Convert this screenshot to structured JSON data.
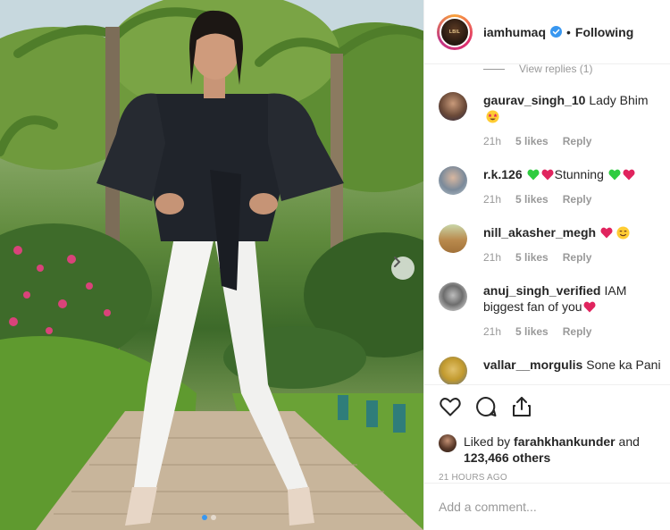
{
  "post": {
    "username": "iamhumaq",
    "follow_status": "Following",
    "separator": "•",
    "avatar_badge": "LBIL",
    "carousel": {
      "total": 2,
      "active": 1
    }
  },
  "comments": {
    "view_replies": "View replies (1)",
    "items": [
      {
        "user": "gaurav_singh_10",
        "text": "Lady Bhim",
        "emoji": "star-struck-face",
        "time": "21h",
        "likes": "5 likes",
        "reply": "Reply"
      },
      {
        "user": "r.k.126",
        "text": "Stunning",
        "emoji": "hearts",
        "time": "21h",
        "likes": "5 likes",
        "reply": "Reply"
      },
      {
        "user": "nill_akasher_megh",
        "text": "",
        "emoji": "heart-smile",
        "time": "21h",
        "likes": "5 likes",
        "reply": "Reply"
      },
      {
        "user": "anuj_singh_verified",
        "text": "IAM biggest fan of you",
        "emoji": "heart",
        "time": "21h",
        "likes": "5 likes",
        "reply": "Reply"
      },
      {
        "user": "vallar__morgulis",
        "text": "Sone ka Pani",
        "emoji": "",
        "time": "",
        "likes": "",
        "reply": ""
      }
    ]
  },
  "actions": {
    "liked_prefix": "Liked by",
    "liked_user": "farahkhankunder",
    "liked_and": "and",
    "liked_others": "123,466 others",
    "posted_time": "21 HOURS AGO"
  },
  "add_comment": {
    "placeholder": "Add a comment..."
  },
  "colors": {
    "accent": "#3897f0",
    "meta": "#999999",
    "text": "#262626",
    "heart_red": "#e0245e",
    "heart_green": "#2ecc40"
  }
}
